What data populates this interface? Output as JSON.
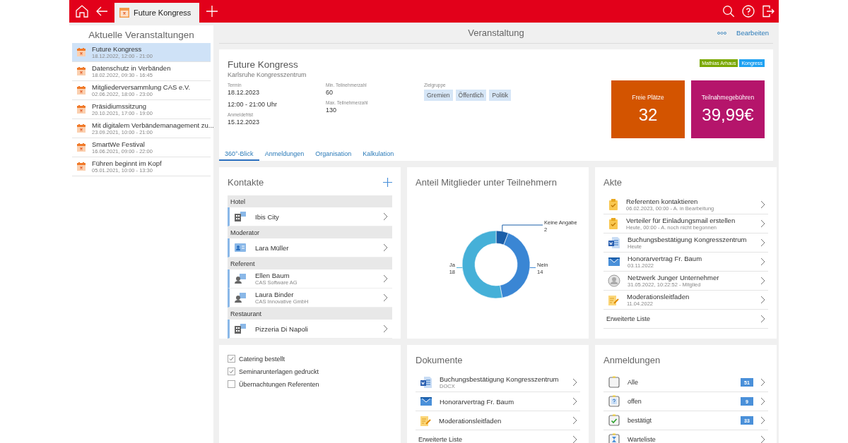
{
  "top_bar": {
    "tabs": [
      {
        "label": "Future Kongress",
        "selected": true
      }
    ]
  },
  "sidebar": {
    "title": "Aktuelle Veranstaltungen",
    "items": [
      {
        "title": "Future Kongress",
        "subtitle": "18.12.2022, 12:00 - 21:00",
        "selected": true
      },
      {
        "title": "Datenschutz in Verbänden",
        "subtitle": "18.02.2022, 09:30 - 16:45",
        "selected": false
      },
      {
        "title": "Mitgliederversammlung CAS e.V.",
        "subtitle": "02.06.2022, 18:00 - 23:00",
        "selected": false
      },
      {
        "title": "Präsidiumssitzung",
        "subtitle": "20.10.2021, 17:00 - 19:00",
        "selected": false
      },
      {
        "title": "Mit digitalem Verbändemanagement zu...",
        "subtitle": "23.09.2021, 10:00 - 21:00",
        "selected": false
      },
      {
        "title": "SmartWe Festival",
        "subtitle": "16.06.2021, 09:00 - 22:00",
        "selected": false
      },
      {
        "title": "Führen beginnt im Kopf",
        "subtitle": "05.01.2021, 10:00 - 13:30",
        "selected": false
      }
    ]
  },
  "header": {
    "title": "Veranstaltung",
    "edit_link": "Bearbeiten"
  },
  "event": {
    "title": "Future Kongress",
    "location": "Karlsruhe Kongresszentrum",
    "columns": [
      [
        {
          "label": "Termin",
          "values": [
            "18.12.2023",
            "12:00 - 21:00 Uhr"
          ]
        },
        {
          "label": "Anmeldefrist",
          "values": [
            "15.12.2023"
          ]
        }
      ],
      [
        {
          "label": "Min. Teilnehmerzahl",
          "values": [
            "60"
          ]
        },
        {
          "label": "Max. Teilnehmerzahl",
          "values": [
            "130"
          ]
        }
      ]
    ],
    "target_group": {
      "label": "Zielgruppe",
      "chips": [
        "Gremien",
        "Öffentlich",
        "Politik"
      ]
    },
    "tags": [
      {
        "label": "Mathias Arhaus",
        "color": "#7aa800"
      },
      {
        "label": "Kongress",
        "color": "#1ea1f2"
      }
    ],
    "tiles": [
      {
        "label": "Freie Plätze",
        "value": "32",
        "color": "#d35400"
      },
      {
        "label": "Teilnahmegebühren",
        "value": "39,99€",
        "color": "#b5156b"
      }
    ]
  },
  "tabs": [
    {
      "label": "360°-Blick",
      "selected": true
    },
    {
      "label": "Anmeldungen",
      "selected": false
    },
    {
      "label": "Organisation",
      "selected": false
    },
    {
      "label": "Kalkulation",
      "selected": false
    }
  ],
  "contacts": {
    "title": "Kontakte",
    "groups": [
      {
        "label": "Hotel",
        "items": [
          {
            "kind": "company",
            "name": "Ibis City"
          }
        ]
      },
      {
        "label": "Moderator",
        "items": [
          {
            "kind": "card",
            "name": "Lara Müller"
          }
        ]
      },
      {
        "label": "Referent",
        "items": [
          {
            "kind": "person",
            "name": "Ellen Baum",
            "company": "CAS Software AG"
          },
          {
            "kind": "person",
            "name": "Laura Binder",
            "company": "CAS Innovative GmbH"
          }
        ]
      },
      {
        "label": "Restaurant",
        "items": [
          {
            "kind": "company",
            "name": "Pizzeria Di Napoli"
          }
        ]
      }
    ]
  },
  "members_chart": {
    "title": "Anteil Mitglieder unter Teilnehmern",
    "chart_data": {
      "type": "donut",
      "categories": [
        "Keine Angabe",
        "Nein",
        "Ja"
      ],
      "values": [
        2,
        14,
        18
      ],
      "data_labels": true
    }
  },
  "file": {
    "title": "Akte",
    "items": [
      {
        "kind": "task",
        "title": "Referenten kontaktieren",
        "subtitle": "06.02.2023, 00:00 - A. in Bearbeitung"
      },
      {
        "kind": "task",
        "title": "Verteiler für Einladungsmail erstellen",
        "subtitle": "Heute, 00:00 - A. noch nicht begonnen"
      },
      {
        "kind": "document",
        "title": "Buchungsbestätigung Kongresszentrum",
        "subtitle": "Heute"
      },
      {
        "kind": "email",
        "title": "Honorarvertrag Fr. Baum",
        "subtitle": "03.11.2022"
      },
      {
        "kind": "member",
        "title": "Netzwerk Junger Unternehmer",
        "subtitle": "31.05.2022, 10:22:52 - Mitglied"
      },
      {
        "kind": "note",
        "title": "Moderationsleitfaden",
        "subtitle": "11.04.2022"
      }
    ],
    "more_link": "Erweiterte Liste"
  },
  "checklist": [
    {
      "label": "Catering bestellt",
      "checked": true
    },
    {
      "label": "Seminarunterlagen gedruckt",
      "checked": true
    },
    {
      "label": "Übernachtungen Referenten",
      "checked": false
    }
  ],
  "documents": {
    "title": "Dokumente",
    "items": [
      {
        "kind": "document",
        "title": "Buchungsbestätigung Kongresszentrum",
        "subtitle": "DOCX"
      },
      {
        "kind": "email",
        "title": "Honorarvertrag Fr. Baum"
      },
      {
        "kind": "note",
        "title": "Moderationsleitfaden"
      }
    ],
    "more_link": "Erweiterte Liste"
  },
  "registrations": {
    "title": "Anmeldungen",
    "items": [
      {
        "kind": "all",
        "label": "Alle",
        "count": "51"
      },
      {
        "kind": "open",
        "label": "offen",
        "count": "9"
      },
      {
        "kind": "confirmed",
        "label": "bestätigt",
        "count": "33"
      },
      {
        "kind": "waiting",
        "label": "Warteliste"
      }
    ]
  }
}
